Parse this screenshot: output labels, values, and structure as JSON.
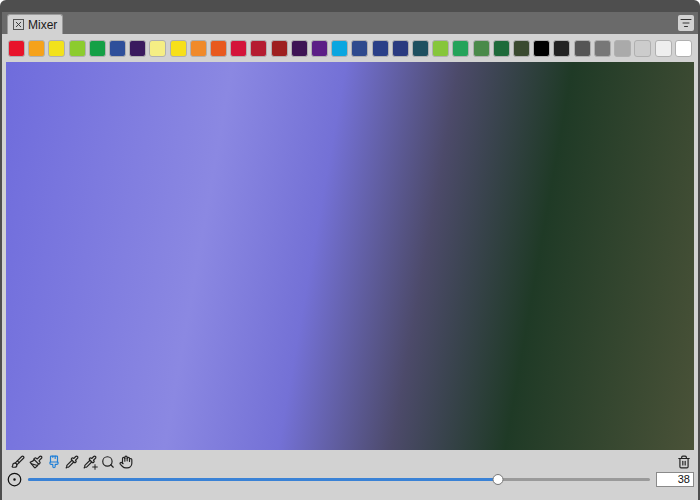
{
  "window": {
    "title": "Mixer"
  },
  "tabs": [
    {
      "label": "Mixer",
      "selected": true
    }
  ],
  "swatches": [
    {
      "color": "#e8132a"
    },
    {
      "color": "#f5a21b"
    },
    {
      "color": "#f2e21c"
    },
    {
      "color": "#8ccc2e"
    },
    {
      "color": "#14a046"
    },
    {
      "color": "#2e4f9a"
    },
    {
      "color": "#3a1a5e"
    },
    {
      "color": "#f5ee84"
    },
    {
      "color": "#f7e01a"
    },
    {
      "color": "#f08a2a"
    },
    {
      "color": "#e8591f"
    },
    {
      "color": "#d4143a"
    },
    {
      "color": "#b51c30"
    },
    {
      "color": "#9e2020"
    },
    {
      "color": "#3e1455"
    },
    {
      "color": "#5c1e86"
    },
    {
      "color": "#0aa6e0"
    },
    {
      "color": "#2e4a8e"
    },
    {
      "color": "#2a3f88"
    },
    {
      "color": "#2a3a80"
    },
    {
      "color": "#1e5060"
    },
    {
      "color": "#86c63a"
    },
    {
      "color": "#24a35a"
    },
    {
      "color": "#4a8a4a"
    },
    {
      "color": "#1e6a3a"
    },
    {
      "color": "#3a4a30"
    },
    {
      "color": "#000000"
    },
    {
      "color": "#222222"
    },
    {
      "color": "#555555"
    },
    {
      "color": "#777777"
    },
    {
      "color": "#aaaaaa"
    },
    {
      "color": "#cccccc"
    },
    {
      "color": "#eeeeee"
    },
    {
      "color": "#ffffff"
    }
  ],
  "tools": [
    {
      "kind": "brush",
      "selected": false
    },
    {
      "kind": "paintbrush",
      "selected": false
    },
    {
      "kind": "blend",
      "selected": true
    },
    {
      "kind": "pipette",
      "selected": false
    },
    {
      "kind": "pipette-plus",
      "selected": false
    },
    {
      "kind": "zoom",
      "selected": false
    },
    {
      "kind": "hand",
      "selected": false
    }
  ],
  "brush_size": {
    "level": 0.755,
    "reading": "38"
  }
}
